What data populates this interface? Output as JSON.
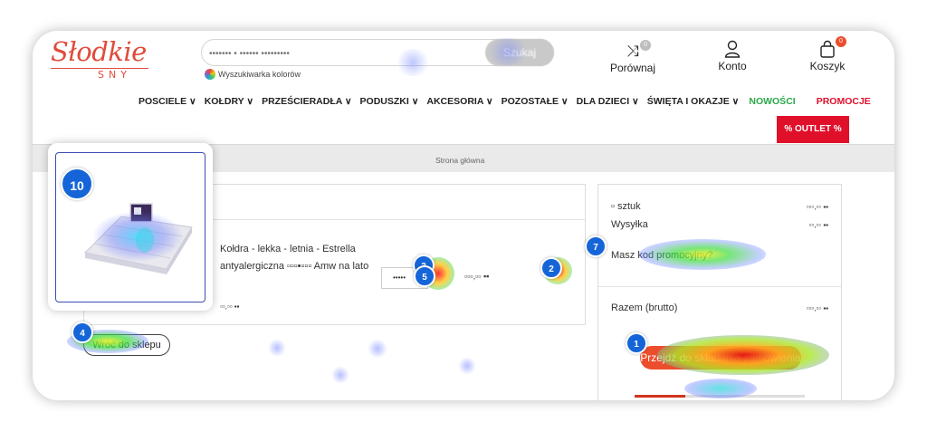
{
  "header": {
    "logo_text": "Słodkie",
    "logo_sub": "SNY",
    "search_placeholder": "••••••• • •••••• •••••••••",
    "search_button": "Szukaj",
    "color_search_label": "Wyszukiwarka kolorów",
    "compare_label": "Porównaj",
    "compare_count": "0",
    "account_label": "Konto",
    "cart_label": "Koszyk",
    "cart_count": "0"
  },
  "nav": {
    "items": [
      "POSCIELE ∨",
      "KOŁDRY ∨",
      "PRZEŚCIERADŁA ∨",
      "PODUSZKI ∨",
      "AKCESORIA ∨",
      "POZOSTAŁE ∨",
      "DLA DZIECI ∨",
      "ŚWIĘTA I OKAZJE ∨"
    ],
    "news": "NOWOŚCI",
    "promo": "PROMOCJE",
    "outlet": "% OUTLET %"
  },
  "breadcrumb": "Strona główna",
  "cart": {
    "product_name": "Kołdra - lekka - letnia - Estrella antyalergiczna ▫▫▫•▫▫▫ Amw na lato",
    "product_price_small": "▫▫,▫▫ ▪▪",
    "quantity": "•••••",
    "row_price": "▫▫▫,▫▫ ▪▪",
    "back_button": "Wróć do sklepu"
  },
  "summary": {
    "items_label": "▫ sztuk",
    "items_value": "▫▫▫,▫▫ ▪▪",
    "shipping_label": "Wysyłka",
    "shipping_value": "▫▫,▫▫ ▪▪",
    "promo_code_link": "Masz kod promocyjny?",
    "total_label": "Razem (brutto)",
    "total_value": "▫▫▫,▫▫ ▪▪",
    "checkout_button": "Przejdź do składania zamówienia",
    "progress_fraction": 0.3
  },
  "markers": [
    "10",
    "4",
    "3",
    "5",
    "2",
    "7",
    "1"
  ],
  "colors": {
    "accent_red": "#e0102b",
    "news_green": "#2aa84a",
    "checkout_orange": "#ec4d2c",
    "marker_blue": "#1565d8"
  }
}
